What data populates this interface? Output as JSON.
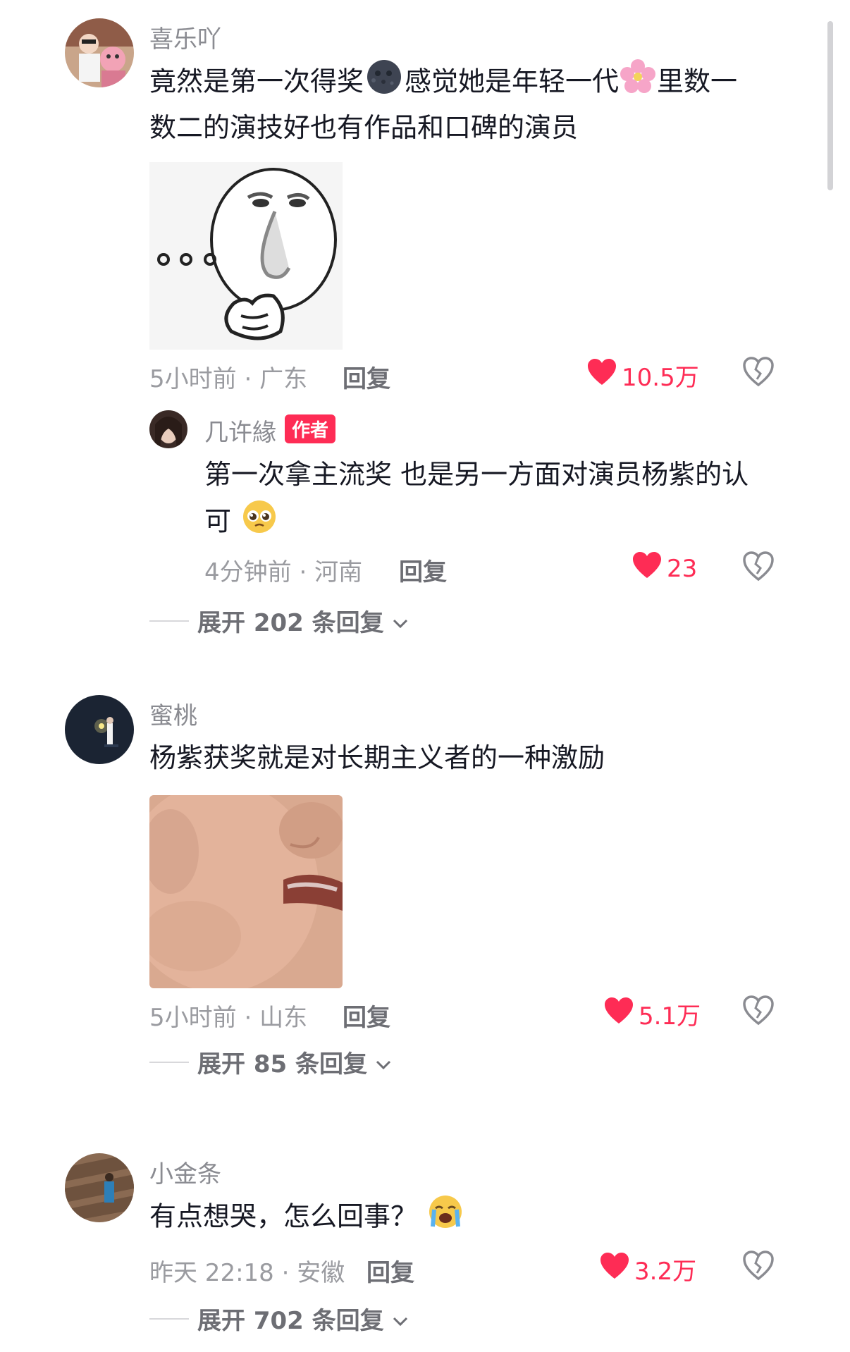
{
  "comments": [
    {
      "username": "喜乐吖",
      "text_line1_a": "竟然是第一次得奖",
      "text_line1_b": "感觉她是年轻一代",
      "text_line1_c": "里数一",
      "text_line2": "数二的演技好也有作品和口碑的演员",
      "emoji_1": "moon-face-emoji",
      "emoji_2": "cherry-blossom-emoji",
      "sticker": "thinking-face-sticker",
      "time": "5小时前",
      "location": "广东",
      "reply_label": "回复",
      "likes": "10.5万",
      "reply": {
        "username": "几许緣",
        "badge": "作者",
        "text_line1": "第一次拿主流奖 也是另一方面对演员杨紫的认",
        "text_line2": "可",
        "emoji": "pleading-face-emoji",
        "time": "4分钟前",
        "location": "河南",
        "reply_label": "回复",
        "likes": "23"
      },
      "expand_label": "展开 202 条回复"
    },
    {
      "username": "蜜桃",
      "text_line1": "杨紫获奖就是对长期主义者的一种激励",
      "sticker": "crying-baby-sticker",
      "time": "5小时前",
      "location": "山东",
      "reply_label": "回复",
      "likes": "5.1万",
      "expand_label": "展开 85 条回复"
    },
    {
      "username": "小金条",
      "text_line1": "有点想哭，怎么回事？",
      "emoji": "loudly-crying-face-emoji",
      "time": "昨天 22:18",
      "location": "安徽",
      "reply_label": "回复",
      "likes": "3.2万",
      "expand_label": "展开 702 条回复"
    }
  ],
  "colors": {
    "accent": "#fe2c55",
    "text": "#161823",
    "muted": "#9a9ba0"
  }
}
